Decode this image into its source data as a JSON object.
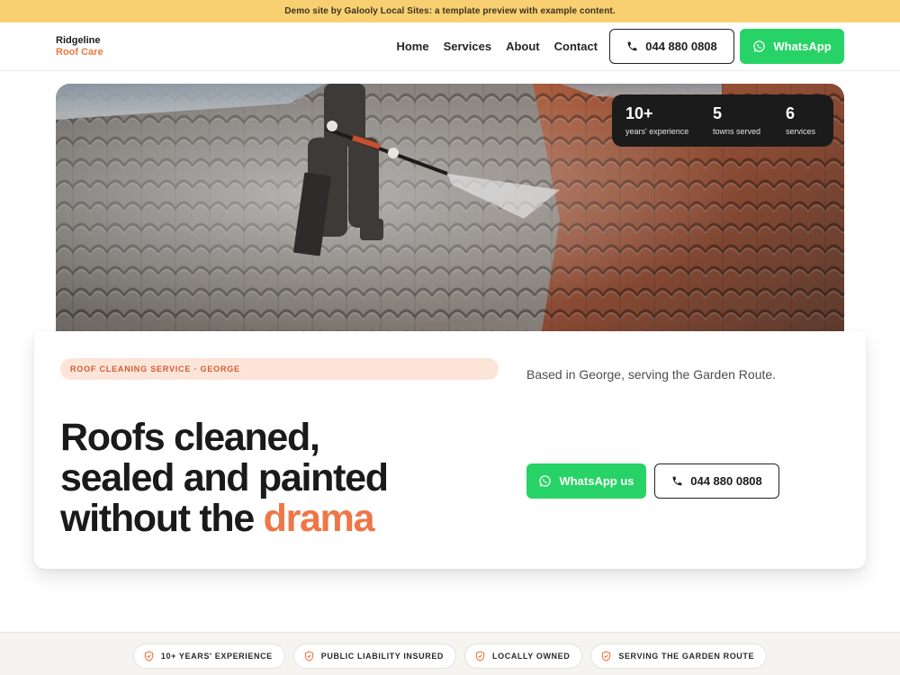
{
  "banner": {
    "text": "Demo site by Galooly Local Sites: a template preview with example content."
  },
  "header": {
    "brand_line1": "Ridgeline",
    "brand_line2": "Roof Care",
    "nav": [
      "Home",
      "Services",
      "About",
      "Contact"
    ],
    "phone_label": "044 880 0808",
    "whatsapp_label": "WhatsApp"
  },
  "stats": [
    {
      "value": "10+",
      "label": "years' experience"
    },
    {
      "value": "5",
      "label": "towns served"
    },
    {
      "value": "6",
      "label": "services"
    }
  ],
  "hero_card": {
    "tag": "ROOF CLEANING SERVICE · GEORGE",
    "headline_line1": "Roofs cleaned,",
    "headline_line2": "sealed and painted",
    "headline_line3_start": "without the ",
    "headline_accent": "drama",
    "based": "Based in George, serving the Garden Route.",
    "whatsapp_label": "WhatsApp us",
    "phone_label": "044 880 0808"
  },
  "trust": [
    "10+ YEARS' EXPERIENCE",
    "PUBLIC LIABILITY INSURED",
    "LOCALLY OWNED",
    "SERVING THE GARDEN ROUTE"
  ],
  "colors": {
    "banner": "#f9d071",
    "accent": "#ee7640",
    "whatsapp": "#27d366",
    "dark": "#1b1b1b"
  },
  "icons": {
    "phone": "phone-icon",
    "whatsapp": "whatsapp-icon",
    "trust": "shield-check-icon"
  }
}
